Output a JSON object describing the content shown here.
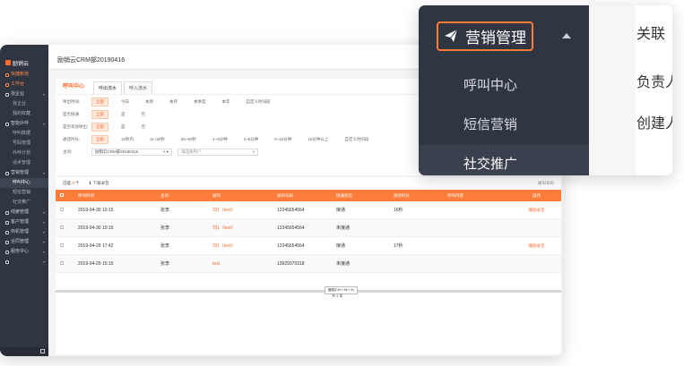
{
  "sidebar": {
    "brand": "励销云",
    "items": [
      {
        "label": "快捷新增",
        "type": "hl"
      },
      {
        "label": "工作台",
        "type": "hl"
      },
      {
        "label": "找企业",
        "type": "group"
      },
      {
        "label": "找企业",
        "type": "sub"
      },
      {
        "label": "我的收藏",
        "type": "sub"
      },
      {
        "label": "智能外呼",
        "type": "group"
      },
      {
        "label": "呼叫数据",
        "type": "sub"
      },
      {
        "label": "号码管理",
        "type": "sub"
      },
      {
        "label": "外呼计划",
        "type": "sub"
      },
      {
        "label": "话术管理",
        "type": "sub"
      },
      {
        "label": "营销管理",
        "type": "group"
      },
      {
        "label": "呼叫中心",
        "type": "active"
      },
      {
        "label": "短信营销",
        "type": "sub"
      },
      {
        "label": "社交推广",
        "type": "sub"
      },
      {
        "label": "线索管理",
        "type": "group"
      },
      {
        "label": "客户管理",
        "type": "group"
      },
      {
        "label": "商机管理",
        "type": "group"
      },
      {
        "label": "合同管理",
        "type": "group"
      },
      {
        "label": "服务中心",
        "type": "group"
      },
      {
        "label": "",
        "type": "group"
      }
    ]
  },
  "header": {
    "title": "励销云CRM部20190416"
  },
  "tabs": {
    "section": "呼叫中心",
    "items": [
      "呼出流水",
      "呼入流水"
    ]
  },
  "filters": {
    "time": {
      "label": "呼出时间:",
      "options": [
        "全部",
        "今日",
        "本周",
        "本月",
        "本季度",
        "本年",
        "自定义时间段"
      ]
    },
    "connected": {
      "label": "是否接通:",
      "options": [
        "全部",
        "是",
        "否"
      ]
    },
    "valid": {
      "label": "是否有效呼出:",
      "options": [
        "全部",
        "是",
        "否"
      ]
    },
    "duration": {
      "label": "通话时长:",
      "options": [
        "全部",
        "10秒内",
        "11~30秒",
        "30~60秒",
        "1~3分钟",
        "3~6分钟",
        "6~10分钟",
        "10分钟以上",
        "自定义时间段"
      ]
    },
    "owner": {
      "label": "主叫:",
      "dept": "励销云CRM部20190416",
      "user_placeholder": "请选择用户"
    }
  },
  "toolbar": {
    "selected_prefix": "已选",
    "selected_count": "0",
    "selected_suffix": "个",
    "download": "下载录音",
    "right": "被叫号码"
  },
  "table": {
    "headers": [
      "呼叫时间",
      "主叫",
      "被叫",
      "被叫号码",
      "接通状态",
      "通话时长",
      "呼叫内容",
      "操作"
    ],
    "rows": [
      {
        "time": "2019-04-30 10:15",
        "caller": "张李",
        "callee": "刘1",
        "callee_tag": "（test）",
        "number": "12345654564",
        "status": "接通",
        "duration": "16秒",
        "action": "播放录音"
      },
      {
        "time": "2019-04-30 10:15",
        "caller": "张李",
        "callee": "刘1",
        "callee_tag": "（test）",
        "number": "12345654564",
        "status": "未接通",
        "duration": "",
        "action": ""
      },
      {
        "time": "2019-04-29 17:42",
        "caller": "张李",
        "callee": "刘1",
        "callee_tag": "（test）",
        "number": "12345654564",
        "status": "接通",
        "duration": "17秒",
        "action": "播放录音"
      },
      {
        "time": "2019-04-29 15:15",
        "caller": "张李",
        "callee": "",
        "callee_tag": "test",
        "number": "13929370318",
        "status": "未接通",
        "duration": "",
        "action": ""
      }
    ],
    "tooltip": "截图(Ctrl + Alt + A)",
    "total": "共 4 条"
  },
  "zoom": {
    "header": "营销管理",
    "items": [
      "呼叫中心",
      "短信营销",
      "社交推广"
    ],
    "right_texts": [
      "关联",
      "负责人",
      "创建人"
    ],
    "colors": {
      "accent": "#ff7a33",
      "dark": "#2f3541"
    }
  }
}
